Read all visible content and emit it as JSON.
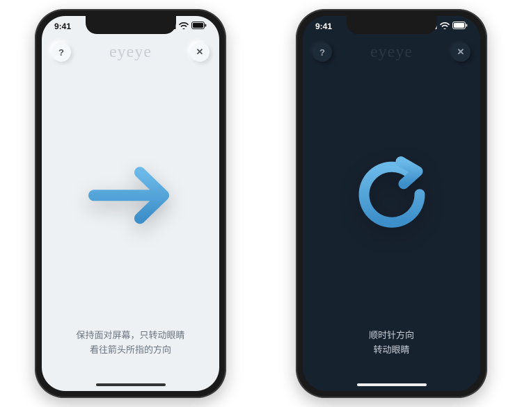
{
  "status": {
    "time": "9:41"
  },
  "app": {
    "logo": "eyeye"
  },
  "buttons": {
    "help": "?",
    "close": "✕"
  },
  "icons": {
    "arrow_right": "arrow-right-icon",
    "rotate_cw": "rotate-clockwise-icon",
    "signal": "signal-icon",
    "wifi": "wifi-icon",
    "battery": "battery-icon"
  },
  "colors": {
    "accent": "#4fa3e0",
    "accent_dark": "#3d8fc9"
  },
  "left": {
    "theme": "light",
    "instructions_line1": "保持面对屏幕，只转动眼睛",
    "instructions_line2": "看往箭头所指的方向"
  },
  "right": {
    "theme": "dark",
    "instructions_line1": "顺时针方向",
    "instructions_line2": "转动眼睛"
  }
}
